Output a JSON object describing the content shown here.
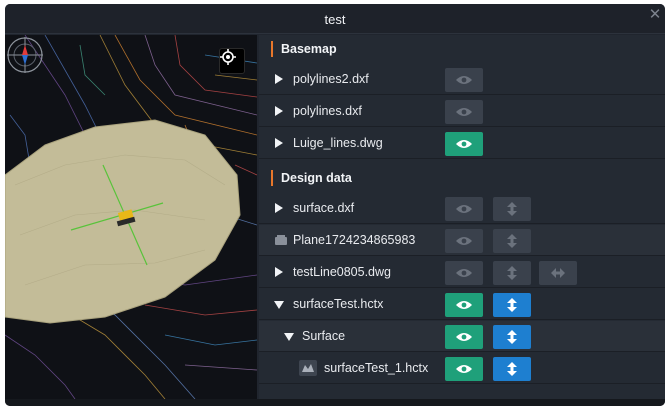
{
  "window": {
    "title": "test",
    "close_glyph": "✕"
  },
  "map": {
    "compass_icon": "compass-icon",
    "locate_icon": "crosshair-icon",
    "colors": {
      "surface": "#c3bc98",
      "axis": "#58c33a",
      "machine": "#e8b818"
    }
  },
  "colors": {
    "accent": "#e8772b",
    "eye_on": "#1fa07a",
    "arrow_on": "#1e7fd0",
    "button_off": "#3a414c"
  },
  "sections": [
    {
      "label": "Basemap",
      "rows": [
        {
          "name": "polylines2.dxf",
          "expand": "collapsed",
          "visible": false
        },
        {
          "name": "polylines.dxf",
          "expand": "collapsed",
          "visible": false
        },
        {
          "name": "Luige_lines.dwg",
          "expand": "collapsed",
          "visible": true
        }
      ]
    },
    {
      "label": "Design data",
      "rows": [
        {
          "name": "surface.dxf",
          "expand": "collapsed",
          "visible": false,
          "active": false
        },
        {
          "name": "Plane1724234865983",
          "icon": "plane-file-icon",
          "visible": false,
          "active": false
        },
        {
          "name": "testLine0805.dwg",
          "expand": "collapsed",
          "visible": false,
          "active": false,
          "horizontal": false
        },
        {
          "name": "surfaceTest.hctx",
          "expand": "expanded",
          "visible": true,
          "active": true
        },
        {
          "name": "Surface",
          "expand": "expanded",
          "visible": true,
          "active": true
        },
        {
          "name": "surfaceTest_1.hctx",
          "icon": "surface-file-icon",
          "visible": true,
          "active": true
        }
      ]
    }
  ]
}
